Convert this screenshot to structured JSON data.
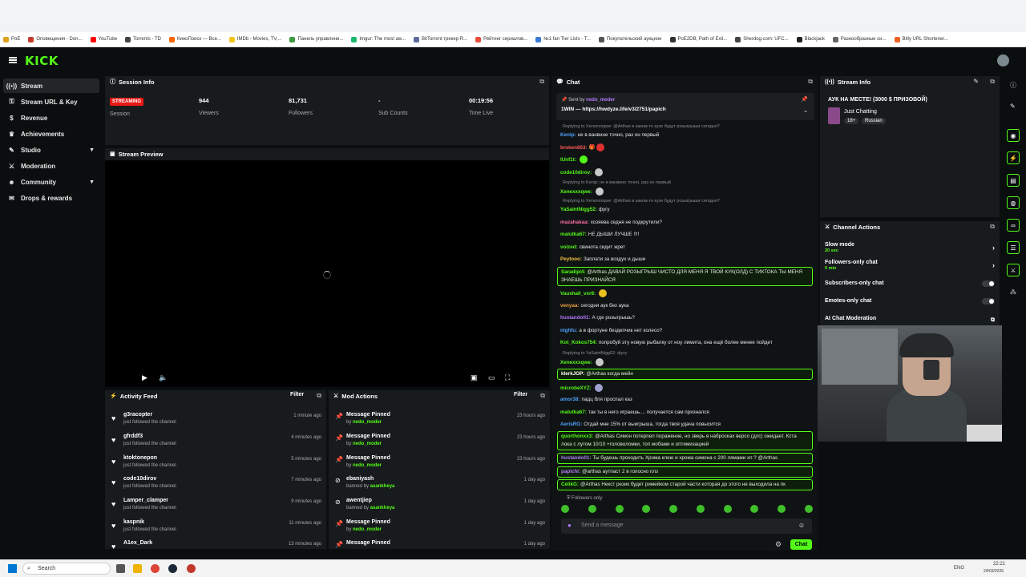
{
  "bookmarks": [
    "PoE",
    "Оповещения - Don...",
    "YouTube",
    "Torrents - TD",
    "КиноПоиск — Все...",
    "IMDb - Movies, TV,...",
    "Панель управлени...",
    "Imgur: The most aw...",
    "BitTorrent трекер R...",
    "Рейтинг сериалов...",
    "№1 fan Tier Lists - T...",
    "Покупательский аукцион",
    "PoE2DB, Path of Exil...",
    "Sherdog.com: UFC...",
    "Blackjack",
    "Разнообразные си...",
    "Bitly URL Shortener..."
  ],
  "header": {
    "logo": "KICK"
  },
  "sidebar": {
    "items": [
      {
        "label": "Stream",
        "icon": "signal-icon"
      },
      {
        "label": "Stream URL & Key",
        "icon": "key-icon"
      },
      {
        "label": "Revenue",
        "icon": "dollar-icon"
      },
      {
        "label": "Achievements",
        "icon": "trophy-icon"
      },
      {
        "label": "Studio",
        "icon": "brush-icon"
      },
      {
        "label": "Moderation",
        "icon": "sword-icon"
      },
      {
        "label": "Community",
        "icon": "people-icon"
      },
      {
        "label": "Drops & rewards",
        "icon": "gift-icon"
      }
    ]
  },
  "session": {
    "title": "Session Info",
    "status_badge": "STREAMING",
    "session_label": "Session",
    "stats": [
      {
        "value": "944",
        "label": "Viewers"
      },
      {
        "value": "81,731",
        "label": "Followers"
      },
      {
        "value": "-",
        "label": "Sub Counts"
      },
      {
        "value": "00:19:56",
        "label": "Time Live"
      }
    ]
  },
  "preview": {
    "title": "Stream Preview"
  },
  "activity": {
    "title": "Activity Feed",
    "filter": "Filter",
    "items": [
      {
        "name": "g3racopter",
        "sub": "just followed the channel",
        "time": "1 minute ago"
      },
      {
        "name": "gfrddf3",
        "sub": "just followed the channel",
        "time": "4 minutes ago"
      },
      {
        "name": "ktoktonepon",
        "sub": "just followed the channel",
        "time": "5 minutes ago"
      },
      {
        "name": "code10dirov",
        "sub": "just followed the channel",
        "time": "7 minutes ago"
      },
      {
        "name": "Lamper_clamper",
        "sub": "just followed the channel",
        "time": "9 minutes ago"
      },
      {
        "name": "kaspnik",
        "sub": "just followed the channel",
        "time": "11 minutes ago"
      },
      {
        "name": "A1ex_Dark",
        "sub": "",
        "time": "13 minutes ago"
      }
    ]
  },
  "mod_actions": {
    "title": "Mod Actions",
    "filter": "Filter",
    "items": [
      {
        "title": "Message Pinned",
        "by": "by",
        "who": "nedo_moder",
        "time": "23 hours ago",
        "icon": "pin-icon"
      },
      {
        "title": "Message Pinned",
        "by": "by",
        "who": "nedo_moder",
        "time": "23 hours ago",
        "icon": "pin-icon"
      },
      {
        "title": "Message Pinned",
        "by": "by",
        "who": "nedo_moder",
        "time": "23 hours ago",
        "icon": "pin-icon"
      },
      {
        "title": "ebaniyash",
        "by": "banned by",
        "who": "asankheya",
        "time": "1 day ago",
        "icon": "ban-icon"
      },
      {
        "title": "awentjiep",
        "by": "banned by",
        "who": "asankheya",
        "time": "1 day ago",
        "icon": "ban-icon"
      },
      {
        "title": "Message Pinned",
        "by": "by",
        "who": "nedo_moder",
        "time": "1 day ago",
        "icon": "pin-icon"
      },
      {
        "title": "Message Pinned",
        "by": "",
        "who": "",
        "time": "1 day ago",
        "icon": "pin-icon"
      }
    ]
  },
  "chat": {
    "title": "Chat",
    "pinned_by": "Sent by",
    "pinned_user": "nedo_moder",
    "pinned_text": "1WIN — https://hwdyze.life/v3/2751/papich",
    "followers_only": "Followers only",
    "input_placeholder": "Send a message",
    "send_label": "Chat",
    "messages": [
      {
        "reply": "Replying to Xenexxxqwe: @Arthas в каком-то кузе будут розыгрыши сегодня?",
        "user": "Kenip:",
        "color": "#4fa3ff",
        "text": "не в ванвине точно, раз он первый"
      },
      {
        "user": "broken653:",
        "color": "#ff5a5a",
        "text": "🎁"
      },
      {
        "user": "lUnf1t:",
        "color": "#53fc18",
        "text": ""
      },
      {
        "user": "code10dirov:",
        "color": "#53fc18",
        "text": ""
      },
      {
        "reply": "Replying to Kenip: не в ванвине точно, раз он первый",
        "user": "Xenexxxqwe:",
        "color": "#53fc18",
        "text": ""
      },
      {
        "reply": "Replying to Xenexxxqwe: @Arthas в каком-то кузе будут розыгрыши сегодня?",
        "user": "YaSaintNigg52:",
        "color": "#53fc18",
        "text": "фугу"
      },
      {
        "user": "mazahakaa:",
        "color": "#ff6fa8",
        "text": "хозяева седня не подкрутили?"
      },
      {
        "user": "malutka67:",
        "color": "#53fc18",
        "text": "НЕ ДЫШИ ЛУЧШЕ !!!!"
      },
      {
        "user": "voized:",
        "color": "#53fc18",
        "text": "свинота сидит жрет"
      },
      {
        "user": "Peytooo:",
        "color": "#f0c040",
        "text": "Заплати за воздух и дыши"
      },
      {
        "user": "Saradipi4:",
        "color": "#53fc18",
        "text": "@Arthas ДАВАЙ РОЗЫГРЫШ ЧИСТО ДЛЯ МЕНЯ Я ТВОЙ КУК(ОЛД) С ТИКТОКА ТЫ МЕНЯ ЗНАЕШЬ ПРИЗНАЙСЯ"
      },
      {
        "user": "Vauxhall_vxr8:",
        "color": "#53fc18",
        "text": ""
      },
      {
        "user": "venyaa:",
        "color": "#f0a040",
        "text": "сегодня аук без аука"
      },
      {
        "user": "hustandoll1:",
        "color": "#b57aff",
        "text": "А где розыгрышь?"
      },
      {
        "user": "nighfu:",
        "color": "#4fa3ff",
        "text": "а в фортуне бездепчик нет колесо?"
      },
      {
        "user": "Kot_Kokos754:",
        "color": "#53fc18",
        "text": "попробуй эту новую рыбалку от ноу лимита, она ещё более менее пойдет"
      },
      {
        "reply": "Replying to YaSaintNigg52: фугу",
        "user": "Xenexxxqwe:",
        "color": "#53fc18",
        "text": ""
      },
      {
        "user": "klerkJOP:",
        "color": "#ffffff",
        "text": "@Arthas когда мейн"
      },
      {
        "user": "microbeXYZ:",
        "color": "#53fc18",
        "text": ""
      },
      {
        "user": "amor38:",
        "color": "#4fa3ff",
        "text": "падц бля проспал каз"
      },
      {
        "user": "malutka67:",
        "color": "#53fc18",
        "text": "так ты в него играешь.... получается сам признался"
      },
      {
        "user": "AerisRG:",
        "color": "#4fa3ff",
        "text": "Отдай мне 15% от выигрыша, тогда твоя удача повысится"
      },
      {
        "user": "quorthonxx3:",
        "color": "#53fc18",
        "text": "@Arthas Симон потерпел поражение, но зверь в набросках версо (длс) ожидает. Кста лока с лутом 10/10 +головоломки, топ мобами и оптимизацией"
      },
      {
        "user": "hustandoll1:",
        "color": "#b57aff",
        "text": "Ты будешь проходить Хрома клею и хрома симона с 200 лямами хп ? @Arthas"
      },
      {
        "user": "papichi:",
        "color": "#b57aff",
        "text": "@arthas аутпаст 2 в голосно плз"
      },
      {
        "user": "CelikG:",
        "color": "#53fc18",
        "text": "@Arthas Некст резик будет римейком старой части которая до этого не выходила на пк"
      }
    ]
  },
  "stream_info": {
    "title": "Stream Info",
    "stream_title": "АУК НА МЕСТЕ! (3000 $ ПРИЗОВОЙ)",
    "category": "Just Chatting",
    "tags": [
      "18+",
      "Russian"
    ]
  },
  "channel_actions": {
    "title": "Channel Actions",
    "rows": [
      {
        "label": "Slow mode",
        "sub": "20 sec",
        "control": "arrow"
      },
      {
        "label": "Followers-only chat",
        "sub": "5 min",
        "control": "arrow"
      },
      {
        "label": "Subscribers-only chat",
        "sub": "",
        "control": "toggle"
      },
      {
        "label": "Emotes-only chat",
        "sub": "",
        "control": "toggle"
      },
      {
        "label": "AI Chat Moderation",
        "sub": "",
        "control": "popout"
      }
    ]
  },
  "taskbar": {
    "search_placeholder": "Search",
    "lang": "ENG",
    "time": "22:21",
    "date": "24/03/2026"
  },
  "colors": {
    "accent": "#53fc18",
    "streaming": "#e91916",
    "bg": "#0b0e0f",
    "panel": "#181b1d"
  }
}
